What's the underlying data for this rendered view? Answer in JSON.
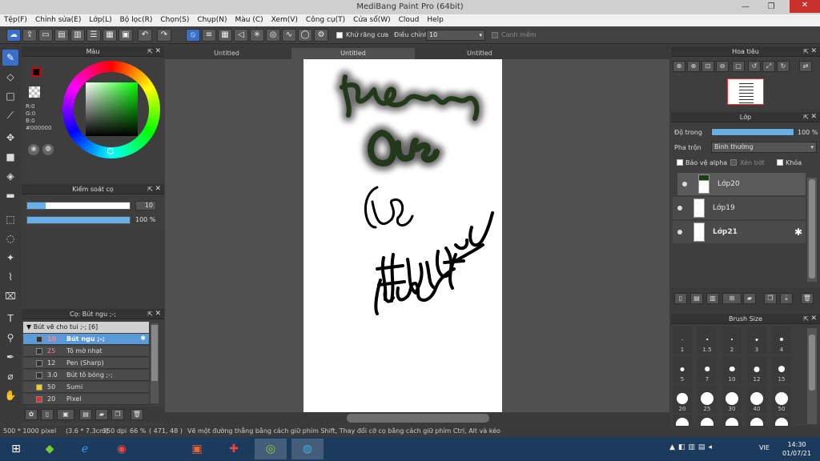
{
  "window": {
    "title": "MediBang Paint Pro (64bit)"
  },
  "menu": [
    "Tệp(F)",
    "Chỉnh sửa(E)",
    "Lớp(L)",
    "Bộ lọc(R)",
    "Chọn(S)",
    "Chụp(N)",
    "Màu (C)",
    "Xem(V)",
    "Công cụ(T)",
    "Cửa sổ(W)",
    "Cloud",
    "Help"
  ],
  "toolbar": {
    "antialias_label": "Khử răng cưa",
    "adjust_label": "Điều chỉnh",
    "adjust_value": "10",
    "snap_label": "Canh mềm"
  },
  "tabs": [
    "Untitled",
    "Untitled",
    "Untitled"
  ],
  "color_panel": {
    "title": "Màu",
    "r": "R:0",
    "g": "G:0",
    "b": "B:0",
    "hex": "#000000",
    "fg": "#000000",
    "bg": "#5b7fc7"
  },
  "brush_control": {
    "title": "Kiểm soát cọ",
    "size": "10",
    "opacity": "100 %",
    "size_fraction": 0.18,
    "opacity_fraction": 1.0
  },
  "brush_list": {
    "title": "Cọ: Bút ngu ;-;",
    "group": "Bút vẽ cho tui ;-; [6]",
    "items": [
      {
        "size": "10",
        "name": "Bút ngu ;-;",
        "color": "#333333",
        "selected": true
      },
      {
        "size": "25",
        "name": "Tô mờ nhạt",
        "color": "#333333",
        "selected": false
      },
      {
        "size": "12",
        "name": "Pen (Sharp)",
        "color": "#333333",
        "selected": false
      },
      {
        "size": "3.0",
        "name": "Bút tô bóng ;-;",
        "color": "#333333",
        "selected": false
      },
      {
        "size": "50",
        "name": "Sumi",
        "color": "#e8d21a",
        "selected": false
      },
      {
        "size": "20",
        "name": "Pixel",
        "color": "#e03030",
        "selected": false
      }
    ]
  },
  "navigator": {
    "title": "Hoa tiêu"
  },
  "layer_panel": {
    "title": "Lớp",
    "opacity_label": "Độ trong",
    "opacity_value": "100 %",
    "blend_label": "Pha trộn",
    "blend_value": "Bình thường",
    "protect_alpha": "Bảo vệ alpha",
    "clipping": "Xén bớt",
    "lock": "Khóa",
    "layers": [
      {
        "name": "Lớp20",
        "selected": false
      },
      {
        "name": "Lớp19",
        "selected": false
      },
      {
        "name": "Lớp21",
        "selected": true
      }
    ]
  },
  "brush_size": {
    "title": "Brush Size",
    "sizes": [
      "1",
      "1.5",
      "2",
      "3",
      "4",
      "5",
      "7",
      "10",
      "12",
      "15",
      "20",
      "25",
      "30",
      "40",
      "50"
    ]
  },
  "status": {
    "dims": "500 * 1000 pixel",
    "cm": "(3.6 * 7.3cm)",
    "dpi": "350 dpi",
    "zoom": "66 %",
    "coord": "( 471, 48 )",
    "hint": "Vẽ một đường thẳng bằng cách giữ phím Shift, Thay đổi cỡ cọ bằng cách giữ phím Ctrl, Alt và kéo"
  },
  "taskbar": {
    "lang": "VIE",
    "time": "14:30",
    "date": "01/07/21"
  }
}
